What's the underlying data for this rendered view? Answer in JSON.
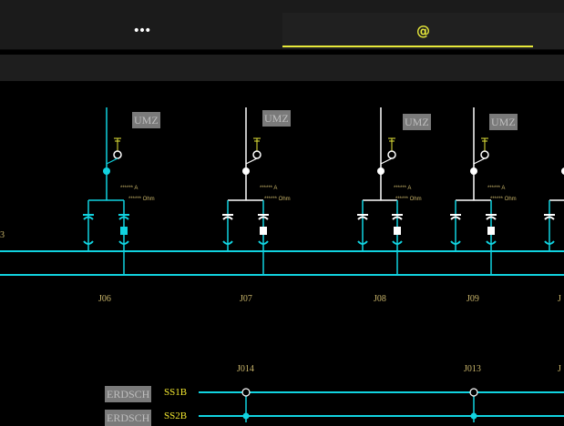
{
  "tabs": [
    {
      "icon": "dots-icon",
      "glyph": "•••"
    },
    {
      "icon": "paperclip-icon",
      "glyph": "@"
    }
  ],
  "colors": {
    "busbar": "#11d3e0",
    "white": "#ffffff",
    "accent": "#e7e93a",
    "label": "#c9b56a"
  },
  "left_edge_label": "3",
  "bays": [
    {
      "name": "J06",
      "umz": "UMZ",
      "current": "****** A",
      "resistance": "****** Ohm"
    },
    {
      "name": "J07",
      "umz": "UMZ",
      "current": "****** A",
      "resistance": "****** Ohm"
    },
    {
      "name": "J08",
      "umz": "UMZ",
      "current": "****** A",
      "resistance": "****** Ohm"
    },
    {
      "name": "J09",
      "umz": "UMZ",
      "current": "****** A",
      "resistance": "****** Ohm"
    },
    {
      "name": "J",
      "umz": "",
      "current": "",
      "resistance": ""
    }
  ],
  "couplers": [
    {
      "name": "J014"
    },
    {
      "name": "J013"
    },
    {
      "name": "J"
    }
  ],
  "busbars_lower": [
    {
      "ground_label": "ERDSCH",
      "name": "SS1B"
    },
    {
      "ground_label": "ERDSCH",
      "name": "SS2B"
    }
  ]
}
